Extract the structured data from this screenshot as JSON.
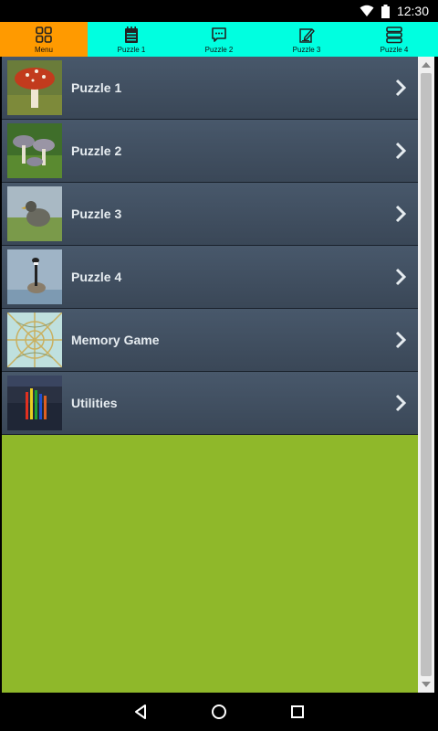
{
  "status_bar": {
    "time": "12:30",
    "icons": [
      "wifi-icon",
      "battery-icon"
    ]
  },
  "tabs": [
    {
      "label": "Menu",
      "icon": "grid-icon",
      "active": true
    },
    {
      "label": "Puzzle 1",
      "icon": "notepad-icon",
      "active": false
    },
    {
      "label": "Puzzle 2",
      "icon": "chat-bubble-icon",
      "active": false
    },
    {
      "label": "Puzzle 3",
      "icon": "edit-icon",
      "active": false
    },
    {
      "label": "Puzzle 4",
      "icon": "stack-icon",
      "active": false
    }
  ],
  "menu_items": [
    {
      "label": "Puzzle 1",
      "thumbnail": "mushroom-thumbnail"
    },
    {
      "label": "Puzzle 2",
      "thumbnail": "mushrooms-cluster-thumbnail"
    },
    {
      "label": "Puzzle 3",
      "thumbnail": "bird-thumbnail"
    },
    {
      "label": "Puzzle 4",
      "thumbnail": "goose-thumbnail"
    },
    {
      "label": "Memory Game",
      "thumbnail": "kaleidoscope-thumbnail"
    },
    {
      "label": "Utilities",
      "thumbnail": "pencils-thumbnail"
    }
  ],
  "nav_buttons": [
    "back-icon",
    "home-icon",
    "recents-icon"
  ],
  "colors": {
    "tab_bar": "#00ffe0",
    "active_tab": "#ff9a00",
    "list_item": "#44546a",
    "content_background": "#8fb82a"
  }
}
